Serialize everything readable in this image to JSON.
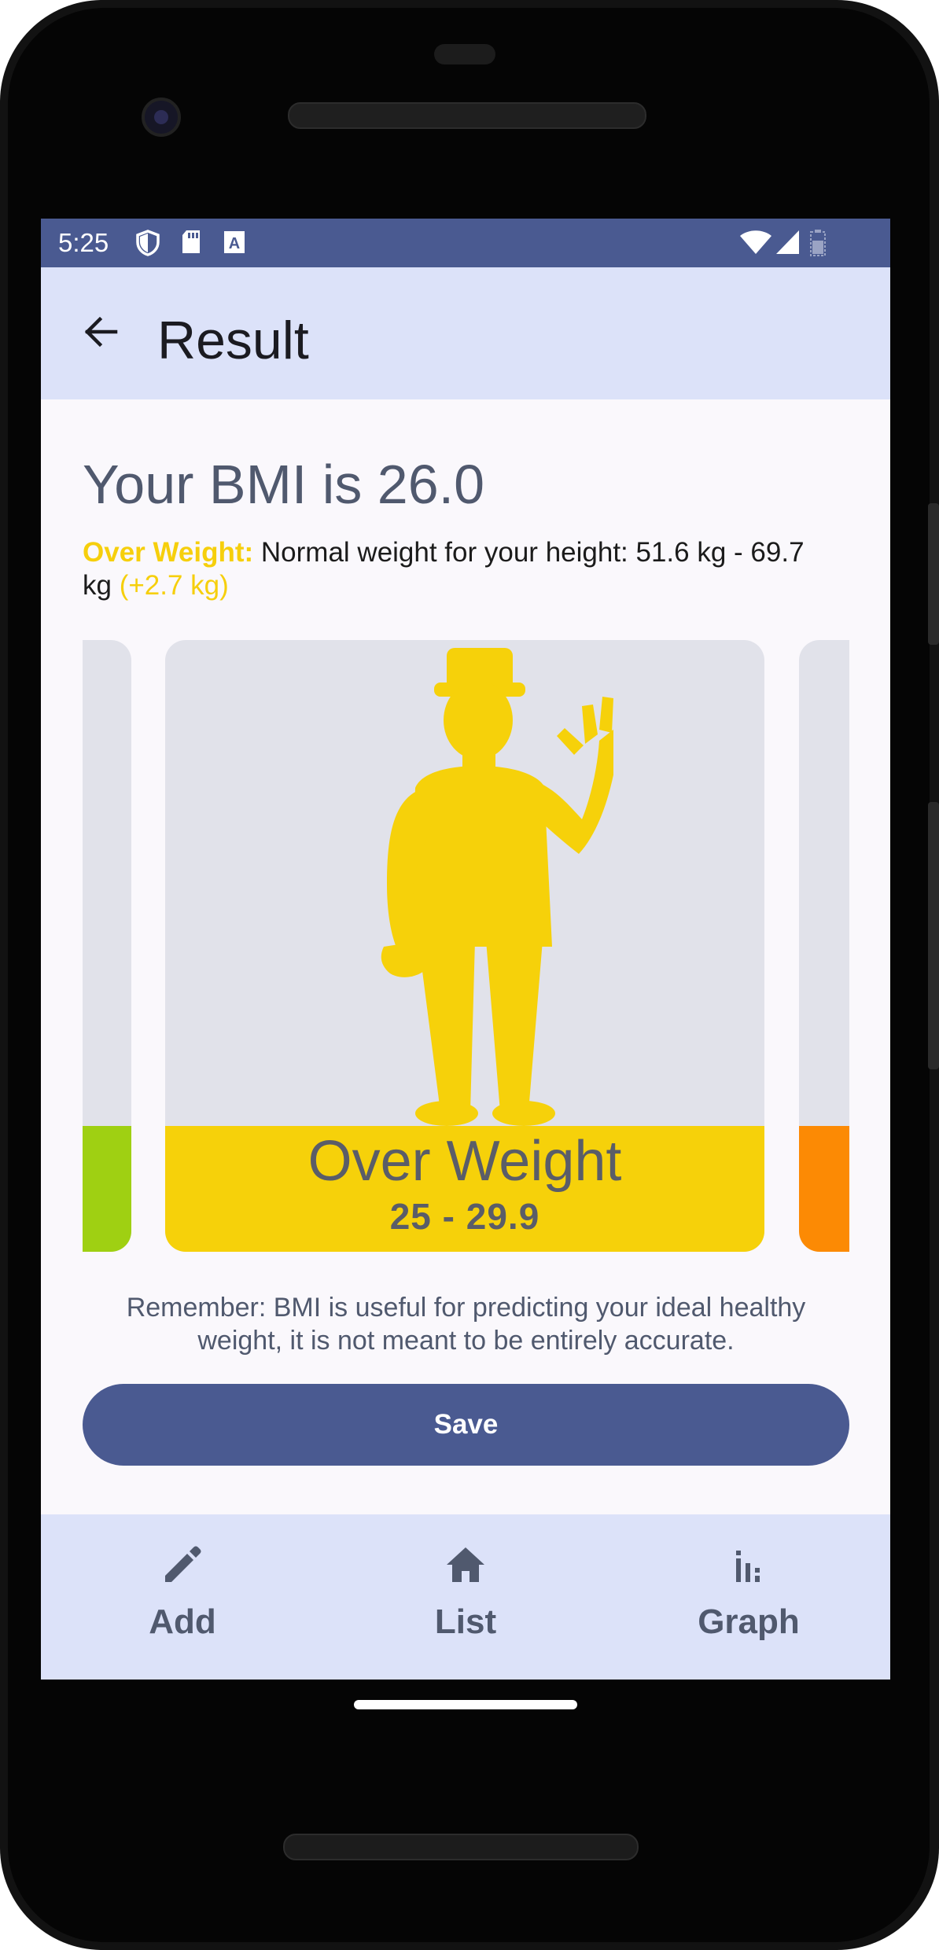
{
  "status_bar": {
    "time": "5:25",
    "left_icons": [
      "shield-icon",
      "sd-card-icon",
      "text-a-icon"
    ],
    "right_icons": [
      "wifi-icon",
      "signal-icon",
      "battery-icon"
    ]
  },
  "app_bar": {
    "title": "Result",
    "back_icon": "arrow-back-icon"
  },
  "result": {
    "bmi_title": "Your BMI is 26.0",
    "category_prefix": "Over Weight:",
    "description": " Normal weight for your height: 51.6 kg - 69.7 kg ",
    "difference": "(+2.7 kg)"
  },
  "carousel": {
    "current": {
      "name": "Over Weight",
      "range": "25 - 29.9",
      "color": "#f6d10a",
      "icon": "waving-person-silhouette-icon"
    },
    "previous_color": "#9fd012",
    "next_color": "#fc8a04"
  },
  "reminder": "Remember: BMI is useful for predicting your ideal healthy weight, it is not meant to be entirely accurate.",
  "save_label": "Save",
  "nav": {
    "items": [
      {
        "label": "Add",
        "icon": "pencil-icon"
      },
      {
        "label": "List",
        "icon": "home-icon"
      },
      {
        "label": "Graph",
        "icon": "bar-chart-icon"
      }
    ]
  },
  "colors": {
    "primary": "#4a5a91",
    "app_bar_bg": "#dce2f9",
    "accent_yellow": "#f6cf0c",
    "text_muted": "#50596e"
  }
}
